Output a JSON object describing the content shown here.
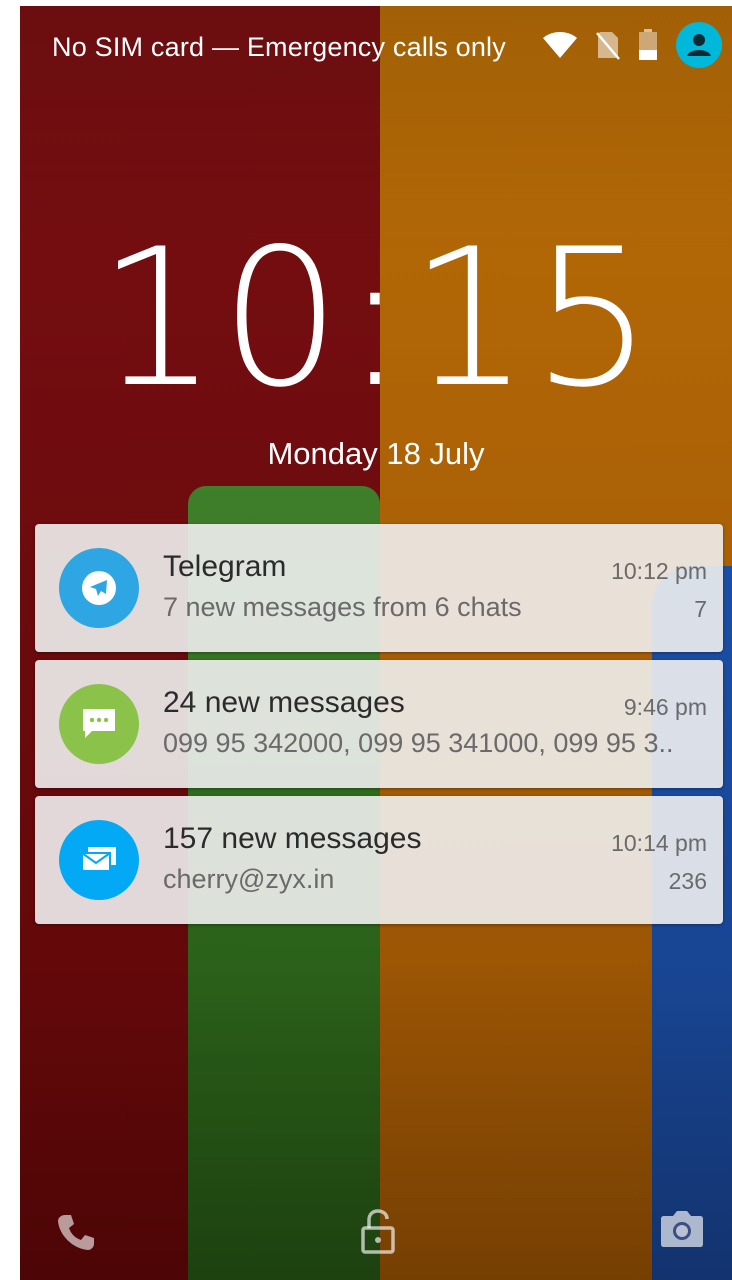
{
  "status_bar": {
    "carrier_text": "No SIM card — Emergency calls only",
    "icons": [
      "wifi-icon",
      "no-sim-icon",
      "battery-icon",
      "user-avatar-icon"
    ]
  },
  "lockscreen": {
    "time": "10:15",
    "date": "Monday 18 July"
  },
  "notifications": [
    {
      "app_icon": "telegram-icon",
      "icon_color": "#2ea6e3",
      "title": "Telegram",
      "text": "7 new messages from 6 chats",
      "time": "10:12 pm",
      "count": "7"
    },
    {
      "app_icon": "sms-icon",
      "icon_color": "#8bc34a",
      "title": "24 new messages",
      "text": "099 95 342000, 099 95 341000, 099 95 3..",
      "time": "9:46 pm",
      "count": ""
    },
    {
      "app_icon": "email-icon",
      "icon_color": "#03a9f4",
      "title": "157 new messages",
      "text": "cherry@zyx.in",
      "time": "10:14 pm",
      "count": "236"
    }
  ],
  "bottom_bar": {
    "icons": [
      "phone-icon",
      "unlock-icon",
      "camera-icon"
    ]
  },
  "colors": {
    "avatar": "#00b8d9"
  }
}
